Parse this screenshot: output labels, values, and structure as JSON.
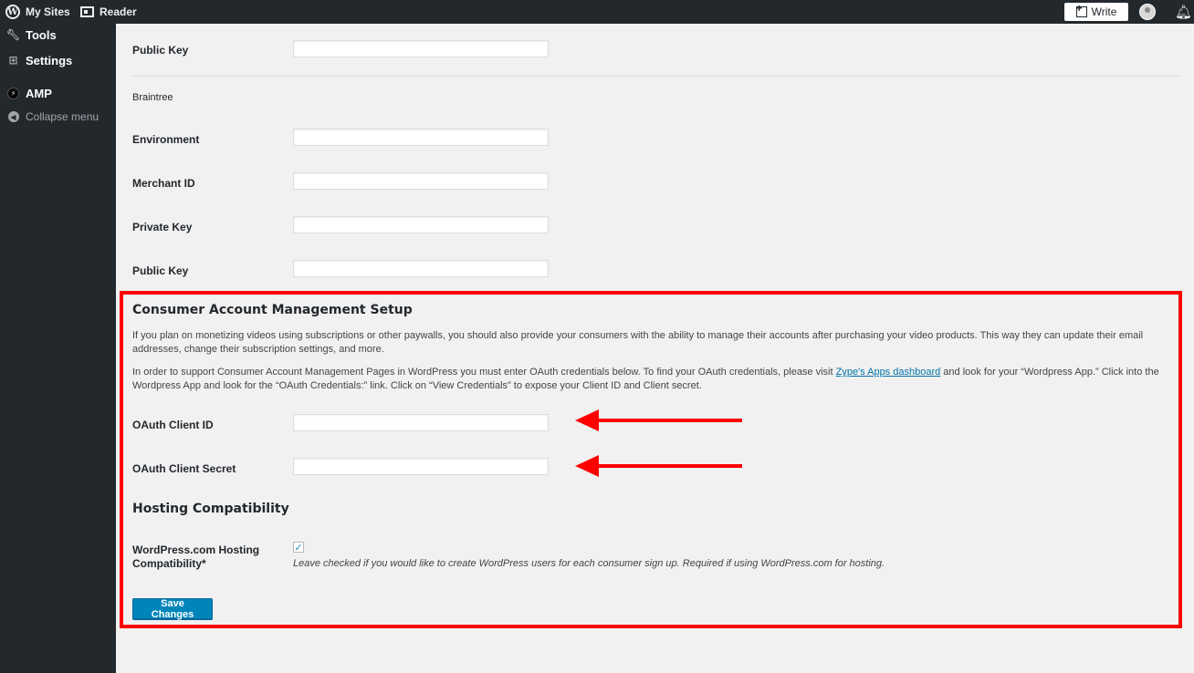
{
  "topbar": {
    "my_sites": "My Sites",
    "reader": "Reader",
    "write": "Write"
  },
  "sidebar": {
    "items": [
      {
        "label": "Tools",
        "icon": "wrench-icon"
      },
      {
        "label": "Settings",
        "icon": "sliders-icon"
      },
      {
        "label": "AMP",
        "icon": "amp-icon"
      },
      {
        "label": "Collapse menu",
        "icon": "collapse-icon"
      }
    ]
  },
  "stripe": {
    "public_key_label": "Public Key",
    "public_key_value": ""
  },
  "braintree": {
    "heading": "Braintree",
    "environment_label": "Environment",
    "environment_value": "",
    "merchant_id_label": "Merchant ID",
    "merchant_id_value": "",
    "private_key_label": "Private Key",
    "private_key_value": "",
    "public_key_label": "Public Key",
    "public_key_value": ""
  },
  "consumer": {
    "title": "Consumer Account Management Setup",
    "para1": "If you plan on monetizing videos using subscriptions or other paywalls, you should also provide your consumers with the ability to manage their accounts after purchasing your video products. This way they can update their email addresses, change their subscription settings, and more.",
    "para2_before": "In order to support Consumer Account Management Pages in WordPress you must enter OAuth credentials below. To find your OAuth credentials, please visit ",
    "para2_link": "Zype's Apps dashboard",
    "para2_after": " and look for your “Wordpress App.” Click into the Wordpress App and look for the “OAuth Credentials:” link. Click on “View Credentials” to expose your Client ID and Client secret.",
    "client_id_label": "OAuth Client ID",
    "client_id_value": "",
    "client_secret_label": "OAuth Client Secret",
    "client_secret_value": ""
  },
  "hosting": {
    "title": "Hosting Compatibility",
    "label_line1": "WordPress.com Hosting",
    "label_line2": "Compatibility*",
    "checked": true,
    "description": "Leave checked if you would like to create WordPress users for each consumer sign up. Required if using WordPress.com for hosting."
  },
  "actions": {
    "save_label": "Save Changes"
  },
  "colors": {
    "highlight": "#ff0000",
    "primary_button": "#0085ba",
    "admin_bar": "#23282d"
  }
}
